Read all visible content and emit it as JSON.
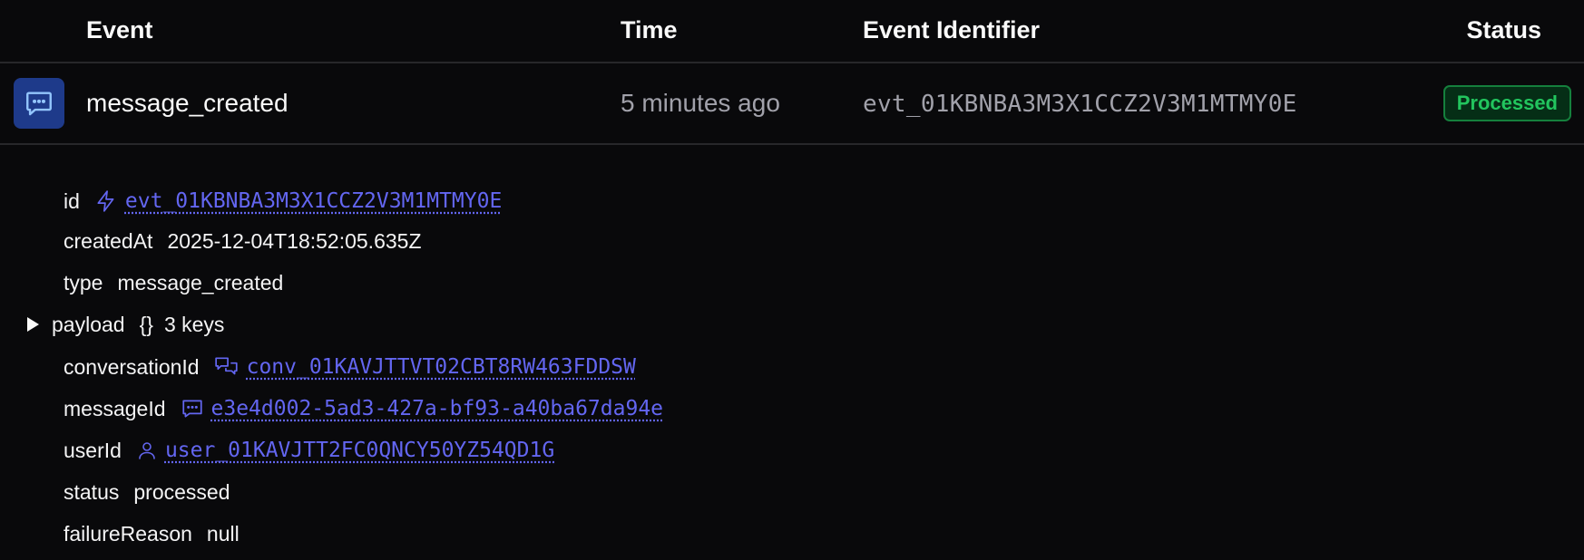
{
  "table": {
    "columns": {
      "event": "Event",
      "time": "Time",
      "identifier": "Event Identifier",
      "status": "Status"
    },
    "row": {
      "icon": "message-icon",
      "name": "message_created",
      "time": "5 minutes ago",
      "identifier": "evt_01KBNBA3M3X1CCZ2V3M1MTMY0E",
      "status": "Processed"
    }
  },
  "detail": {
    "id": {
      "key": "id",
      "value": "evt_01KBNBA3M3X1CCZ2V3M1MTMY0E",
      "icon": "lightning-icon"
    },
    "createdAt": {
      "key": "createdAt",
      "value": "2025-12-04T18:52:05.635Z"
    },
    "type": {
      "key": "type",
      "value": "message_created"
    },
    "payload": {
      "key": "payload",
      "braces": "{}",
      "summary": "3 keys",
      "expanded": true,
      "fields": {
        "conversationId": {
          "key": "conversationId",
          "value": "conv_01KAVJTTVT02CBT8RW463FDDSW",
          "icon": "conversation-icon"
        },
        "messageId": {
          "key": "messageId",
          "value": "e3e4d002-5ad3-427a-bf93-a40ba67da94e",
          "icon": "message-icon"
        },
        "userId": {
          "key": "userId",
          "value": "user_01KAVJTT2FC0QNCY50YZ54QD1G",
          "icon": "user-icon"
        }
      }
    },
    "status": {
      "key": "status",
      "value": "processed"
    },
    "failureReason": {
      "key": "failureReason",
      "value": "null"
    }
  },
  "colors": {
    "background": "#09090b",
    "link": "#6366f1",
    "success": "#22c55e",
    "icon_tile": "#1e3a8a"
  }
}
